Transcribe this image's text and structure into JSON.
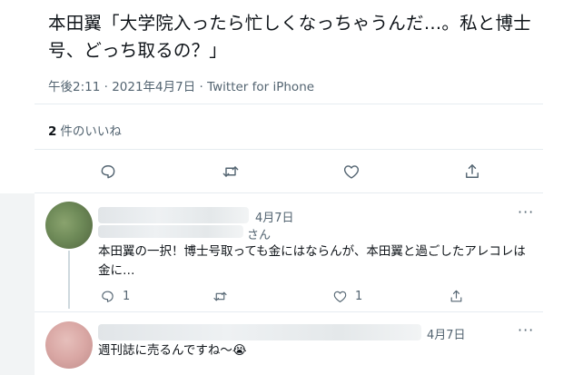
{
  "tweet": {
    "text": "本田翼「大学院入ったら忙しくなっちゃうんだ…。私と博士号、どっち取るの？」",
    "meta": "午後2:11 · 2021年4月7日 · Twitter for iPhone",
    "likes_count": "2",
    "likes_label": "件のいいね"
  },
  "action_icons": [
    "reply-icon",
    "retweet-icon",
    "like-icon",
    "share-icon"
  ],
  "replies": [
    {
      "date": "4月7日",
      "handle_suffix": "さん",
      "text": "本田翼の一択！博士号取っても金にはならんが、本田翼と過ごしたアレコレは金に…",
      "reply_count": "1",
      "retweet_count": "",
      "like_count": "1",
      "more_label": "···",
      "avatar_color": "#6e8a58"
    },
    {
      "date": "4月7日",
      "text": "週刊誌に売るんですね〜😭",
      "more_label": "···",
      "avatar_color": "#d9a7a4"
    }
  ],
  "colors": {
    "text": "#0f1419",
    "secondary": "#536471",
    "divider": "#e6ecf0"
  }
}
